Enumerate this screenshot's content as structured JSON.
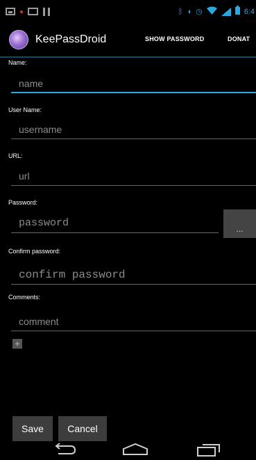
{
  "status_bar": {
    "time": "6:4",
    "icons": [
      "image-icon",
      "notification-dot-icon",
      "mail-icon",
      "pause-icon",
      "bluetooth-icon",
      "vibrate-icon",
      "alarm-icon",
      "wifi-icon",
      "signal-icon",
      "battery-icon"
    ]
  },
  "action_bar": {
    "app_title": "KeePassDroid",
    "show_password": "SHOW PASSWORD",
    "donate": "DONAT"
  },
  "form": {
    "name_label": "Name:",
    "name_placeholder": "name",
    "username_label": "User Name:",
    "username_placeholder": "username",
    "url_label": "URL:",
    "url_placeholder": "url",
    "password_label": "Password:",
    "password_placeholder": "password",
    "generate_label": "...",
    "confirm_label": "Confirm password:",
    "confirm_placeholder": "confirm password",
    "comments_label": "Comments:",
    "comment_placeholder": "comment",
    "add_field_label": "+"
  },
  "buttons": {
    "save": "Save",
    "cancel": "Cancel"
  },
  "navigation": {
    "back": "back-icon",
    "home": "home-icon",
    "recents": "recent-apps-icon"
  },
  "colors": {
    "accent": "#2aa8e0",
    "background": "#000000",
    "button_bg": "#3d3d3d"
  }
}
